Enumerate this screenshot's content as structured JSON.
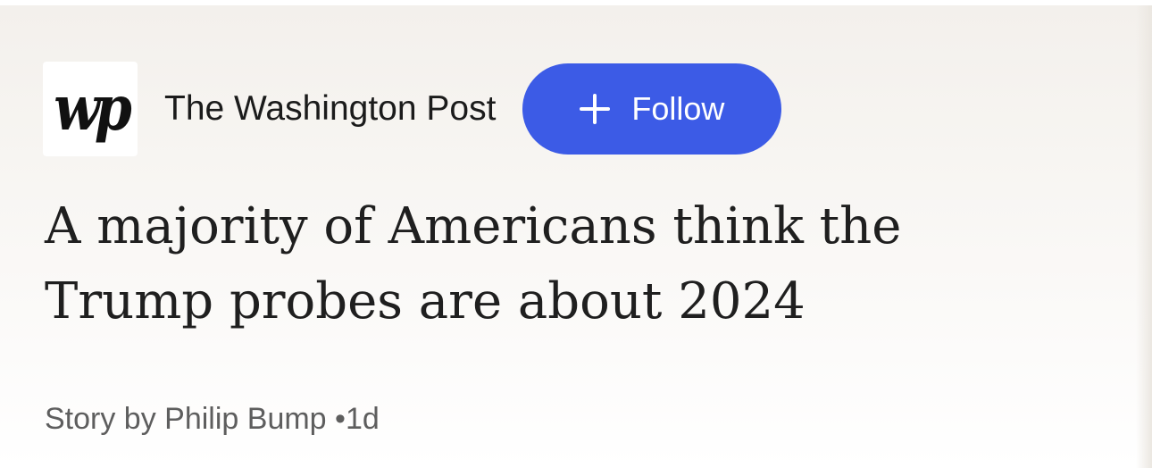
{
  "publisher": {
    "logo_text": "wp",
    "name": "The Washington Post"
  },
  "follow_button": {
    "label": "Follow",
    "icon": "plus-icon",
    "color": "#3c5be6"
  },
  "article": {
    "headline": "A majority of Americans think the Trump probes are about 2024",
    "byline": "Story by Philip Bump",
    "separator": "•",
    "age": "1d"
  }
}
